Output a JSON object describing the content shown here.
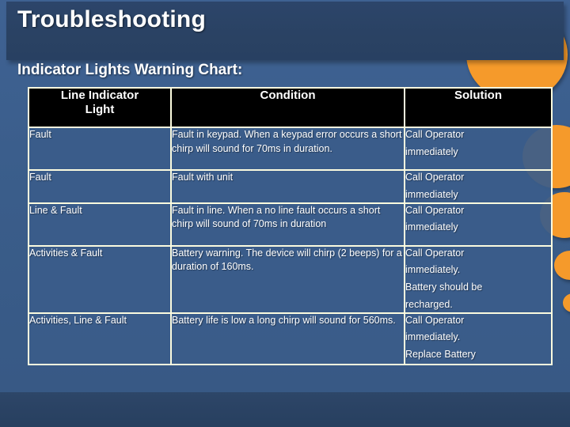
{
  "slide": {
    "title": "Troubleshooting",
    "subtitle": "Indicator Lights Warning Chart:"
  },
  "colors": {
    "background_blue": "#3a5d8a",
    "title_bar_navy": "#2a4263",
    "accent_orange": "#f59a2b",
    "table_border_cream": "#fbfbdf",
    "header_black": "#000000",
    "text_white": "#ffffff"
  },
  "table": {
    "headers": {
      "col1": "Line Indicator Light",
      "col1_line1": "Line Indicator",
      "col1_line2": "Light",
      "col2": "Condition",
      "col3": "Solution"
    },
    "rows": [
      {
        "indicator": "Fault",
        "condition": "Fault in keypad. When a keypad error occurs a short chirp will sound for 70ms in duration.",
        "solution_lines": [
          "Call Operator",
          "immediately"
        ]
      },
      {
        "indicator": "Fault",
        "condition": "Fault with unit",
        "solution_lines": [
          "Call Operator",
          "immediately"
        ]
      },
      {
        "indicator": "Line & Fault",
        "condition": "Fault in line. When a no line fault occurs a short chirp will sound of 70ms in duration",
        "solution_lines": [
          "Call Operator",
          "immediately"
        ]
      },
      {
        "indicator": "Activities & Fault",
        "condition": "Battery warning. The device will chirp (2 beeps) for a duration of 160ms.",
        "solution_lines": [
          "Call Operator",
          "immediately.",
          "Battery should be",
          "recharged."
        ]
      },
      {
        "indicator": "Activities, Line & Fault",
        "condition": "Battery life is low a long chirp will sound for 560ms.",
        "solution_lines": [
          "Call Operator",
          "immediately.",
          "Replace Battery"
        ]
      }
    ]
  },
  "decorations": {
    "circle_count": 5,
    "shape": "circle"
  }
}
